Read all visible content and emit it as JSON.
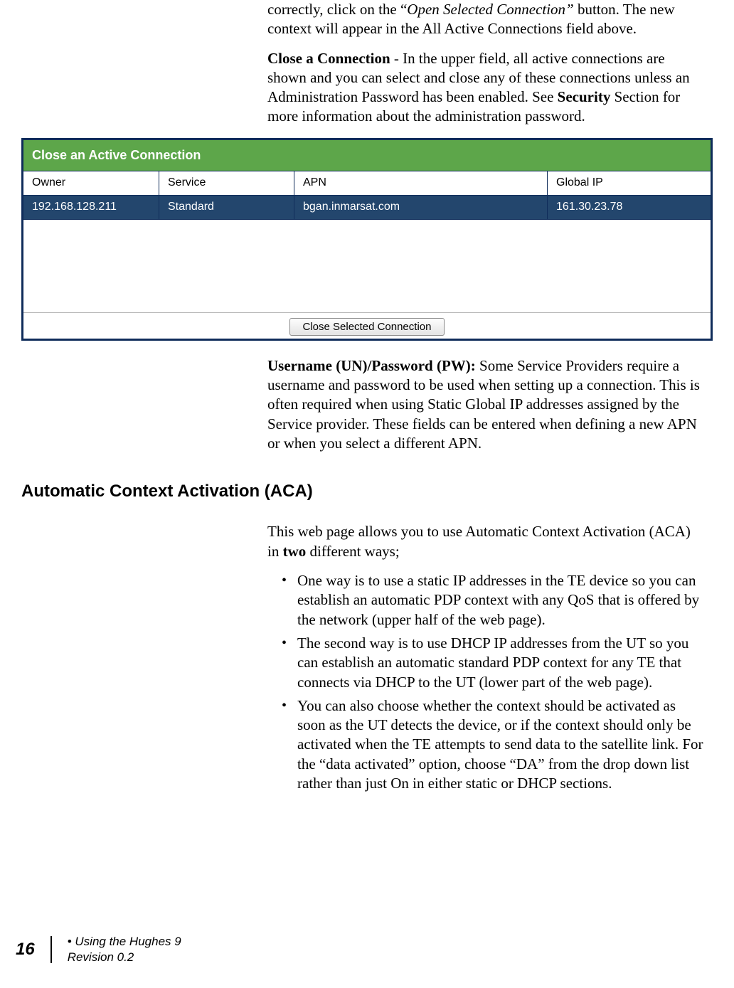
{
  "paragraphs": {
    "intro_tail_pre": "correctly, click on the “",
    "intro_tail_em": "Open Selected Connection”",
    "intro_tail_post": " button.  The new context will appear in the All Active Connections field above.",
    "close_conn_label": "Close a Connection",
    "close_conn_text": " - In the upper field, all active connections are shown and you can select and close any of these connections unless an Administration Password has been enabled.  See ",
    "security_label": "Security",
    "close_conn_text2": " Section for more information about the administration password.",
    "unpw_label": "Username (UN)/Password (PW):",
    "unpw_text": " Some Service Providers require a username and password to be used when setting up a connection.  This is often required when using Static Global IP addresses assigned by the Service provider. These fields can be entered when defining a new APN or when you select a different APN.",
    "aca_heading": "Automatic Context Activation (ACA)",
    "aca_intro_pre": "This web page allows you to use Automatic Context Activation (ACA) in ",
    "aca_intro_bold": "two",
    "aca_intro_post": " different ways;",
    "bullet1": "One way is to use a static IP addresses in the TE device so you can establish an automatic PDP context with any QoS that is offered by the network (upper half of the web page).",
    "bullet2": "The second way is to use DHCP IP addresses from the UT so you can establish an automatic standard PDP context for any TE that connects via DHCP to the UT (lower part of the web page).",
    "bullet3": "You can also choose whether the context should be activated as soon as the UT detects the device, or if the context should only be activated when the TE attempts to send data to the satellite link. For the “data activated” option, choose “DA” from the drop down list rather than just On in either static or DHCP sections."
  },
  "table": {
    "title": "Close an Active Connection",
    "headers": [
      "Owner",
      "Service",
      "APN",
      "Global IP"
    ],
    "row": [
      "192.168.128.211",
      "Standard",
      "bgan.inmarsat.com",
      "161.30.23.78"
    ],
    "button": "Close Selected Connection"
  },
  "footer": {
    "page": "16",
    "line1": "Using the Hughes 9",
    "line2": "Revision 0.2"
  }
}
